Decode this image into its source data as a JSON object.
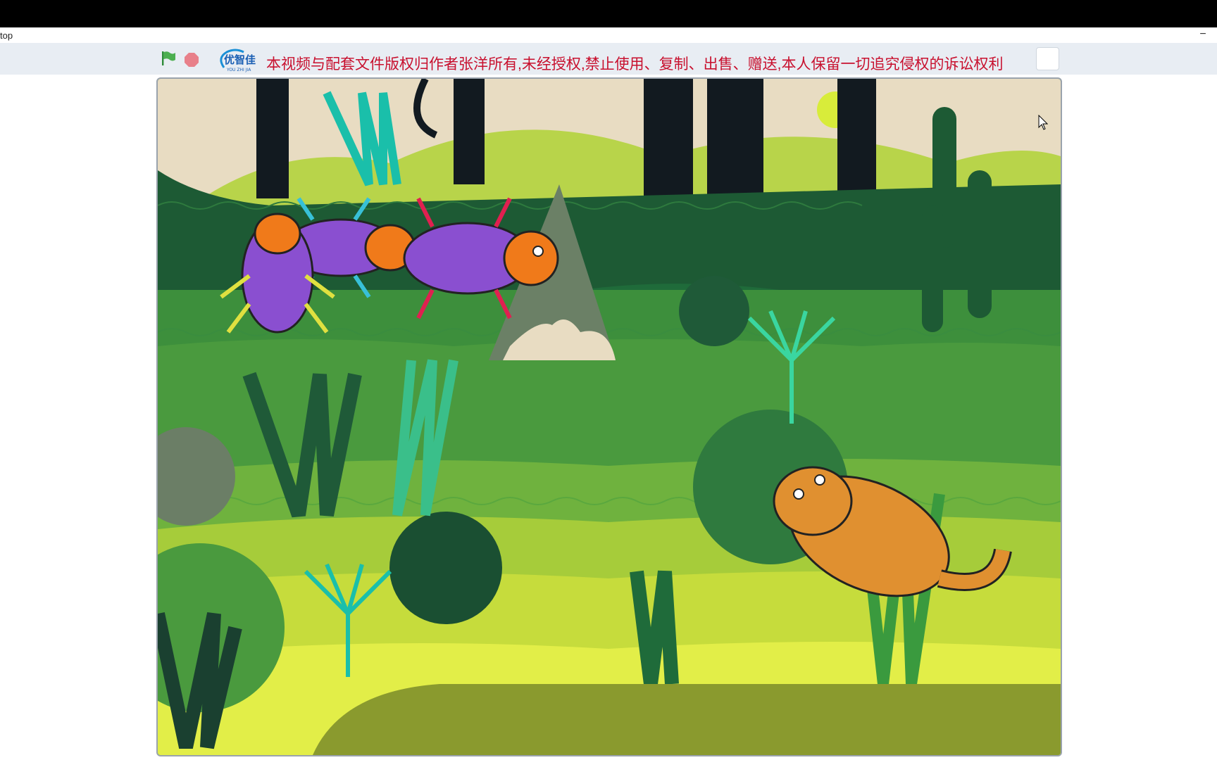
{
  "window": {
    "title": "top"
  },
  "toolbar": {
    "green_flag": "green-flag-icon",
    "stop": "stop-icon",
    "logo_text": "优智佳",
    "logo_sub": "YOU ZHI JIA",
    "notice": "本视频与配套文件版权归作者张洋所有,未经授权,禁止使用、复制、出售、赠送,本人保留一切追究侵权的诉讼权利"
  },
  "colors": {
    "notice_red": "#c8102e",
    "flag_green": "#4caf50",
    "stop_red": "#e8808a",
    "beetle_purple": "#8a4fd0",
    "beetle_orange": "#f07a1a",
    "cat_orange": "#e09030"
  }
}
